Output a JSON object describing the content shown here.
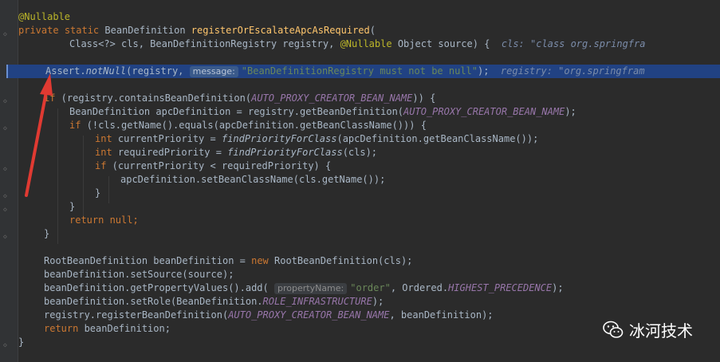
{
  "colors": {
    "background": "#2b2b2b",
    "keyword": "#cc7832",
    "annotation": "#bbb529",
    "method_decl": "#ffc66d",
    "constant": "#9876aa",
    "string": "#6a8759",
    "highlight_line": "#214283",
    "arrow": "#e03a32"
  },
  "code": {
    "l1_annotation": "@Nullable",
    "l2_private": "private",
    "l2_static": "static",
    "l2_type": "BeanDefinition",
    "l2_method": "registerOrEscalateApcAsRequired",
    "l2_paren": "(",
    "l3_params": "Class<?> cls, BeanDefinitionRegistry registry, ",
    "l3_nullable": "@Nullable",
    "l3_rest": " Object source) {",
    "l3_debug": "cls: \"class org.springfra",
    "l5_assert": "Assert.",
    "l5_notnull": "notNull",
    "l5_open": "(registry, ",
    "l5_hint": "message:",
    "l5_str": "\"BeanDefinitionRegistry must not be null\"",
    "l5_close": ");",
    "l5_debug": "registry: \"org.springfram",
    "l7_if": "if",
    "l7_a": " (registry.containsBeanDefinition(",
    "l7_const": "AUTO_PROXY_CREATOR_BEAN_NAME",
    "l7_b": ")) {",
    "l8_a": "BeanDefinition apcDefinition = registry.getBeanDefinition(",
    "l8_const": "AUTO_PROXY_CREATOR_BEAN_NAME",
    "l8_b": ");",
    "l9_if": "if",
    "l9_rest": " (!cls.getName().equals(apcDefinition.getBeanClassName())) {",
    "l10_int": "int",
    "l10_a": " currentPriority = ",
    "l10_fn": "findPriorityForClass",
    "l10_b": "(apcDefinition.getBeanClassName());",
    "l11_int": "int",
    "l11_a": " requiredPriority = ",
    "l11_fn": "findPriorityForClass",
    "l11_b": "(cls);",
    "l12_if": "if",
    "l12_rest": " (currentPriority < requiredPriority) {",
    "l13": "apcDefinition.setBeanClassName(cls.getName());",
    "l14": "}",
    "l15": "}",
    "l16_return": "return",
    "l16_null": " null;",
    "l17": "}",
    "l19_a": "RootBeanDefinition beanDefinition = ",
    "l19_new": "new",
    "l19_b": " RootBeanDefinition(cls);",
    "l20": "beanDefinition.setSource(source);",
    "l21_a": "beanDefinition.getPropertyValues().add(",
    "l21_hint": "propertyName:",
    "l21_str": "\"order\"",
    "l21_b": ", Ordered.",
    "l21_const": "HIGHEST_PRECEDENCE",
    "l21_c": ");",
    "l22_a": "beanDefinition.setRole(BeanDefinition.",
    "l22_const": "ROLE_INFRASTRUCTURE",
    "l22_b": ");",
    "l23_a": "registry.registerBeanDefinition(",
    "l23_const": "AUTO_PROXY_CREATOR_BEAN_NAME",
    "l23_b": ", beanDefinition);",
    "l24_return": "return",
    "l24_rest": " beanDefinition;",
    "l25": "}"
  },
  "watermark": {
    "text": "冰河技术",
    "icon": "wechat-icon"
  }
}
